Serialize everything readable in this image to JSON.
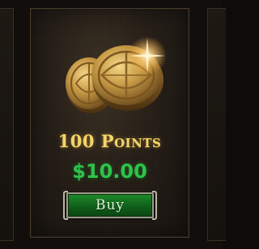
{
  "store_item": {
    "title": "100 Points",
    "price": "$10.00",
    "buy_label": "Buy",
    "art_icon": "coins-icon"
  },
  "colors": {
    "title_gold": "#f2d56b",
    "price_green": "#2fc24a",
    "button_green": "#1f8a2a",
    "card_background": "#241d16"
  }
}
